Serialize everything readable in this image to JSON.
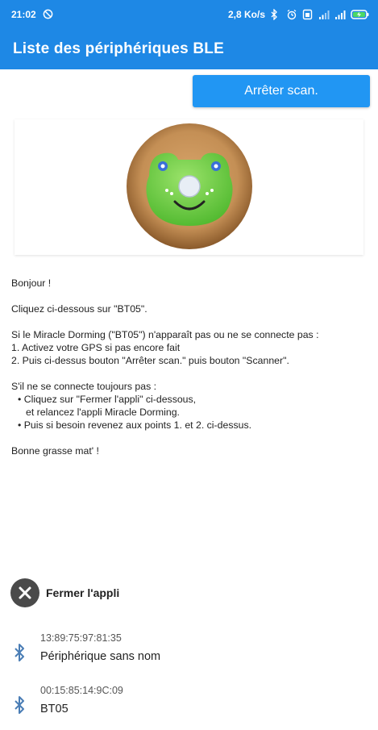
{
  "status_bar": {
    "time": "21:02",
    "network_speed": "2,8 Ko/s",
    "battery_level": 1.0,
    "icons": [
      "notification-blocked-icon",
      "bluetooth-icon",
      "alarm-icon",
      "sim-icon",
      "signal-icon",
      "wifi-icon",
      "battery-charging-icon"
    ]
  },
  "app_bar": {
    "title": "Liste des périphériques BLE"
  },
  "toolbar": {
    "stop_scan_label": "Arrêter scan."
  },
  "message": {
    "greeting": "Bonjour !",
    "instruction": "Cliquez ci-dessous sur \"BT05\".",
    "if_not_visible": "Si le Miracle Dorming (\"BT05\") n'apparaît pas ou ne se connecte pas :",
    "step1": "1. Activez votre GPS si pas encore fait",
    "step2": "2. Puis ci-dessus bouton \"Arrêter scan.\" puis bouton \"Scanner\".",
    "still_not": "S'il ne se connecte toujours pas :",
    "bullet1_line1": "• Cliquez sur \"Fermer l'appli\" ci-dessous,",
    "bullet1_line2": "et relancez l'appli Miracle Dorming.",
    "bullet2": "• Puis si besoin revenez aux points 1. et 2. ci-dessus.",
    "closing": "Bonne grasse mat' !"
  },
  "close_app": {
    "label": "Fermer l'appli",
    "icon": "close-icon"
  },
  "devices": [
    {
      "address": "13:89:75:97:81:35",
      "name": "Périphérique sans nom",
      "icon": "bluetooth-icon"
    },
    {
      "address": "00:15:85:14:9C:09",
      "name": "BT05",
      "icon": "bluetooth-icon"
    }
  ],
  "colors": {
    "primary": "#1e88e5",
    "button": "#2196f3",
    "close_circle": "#4a4a4a",
    "bluetooth": "#4a7db5"
  }
}
